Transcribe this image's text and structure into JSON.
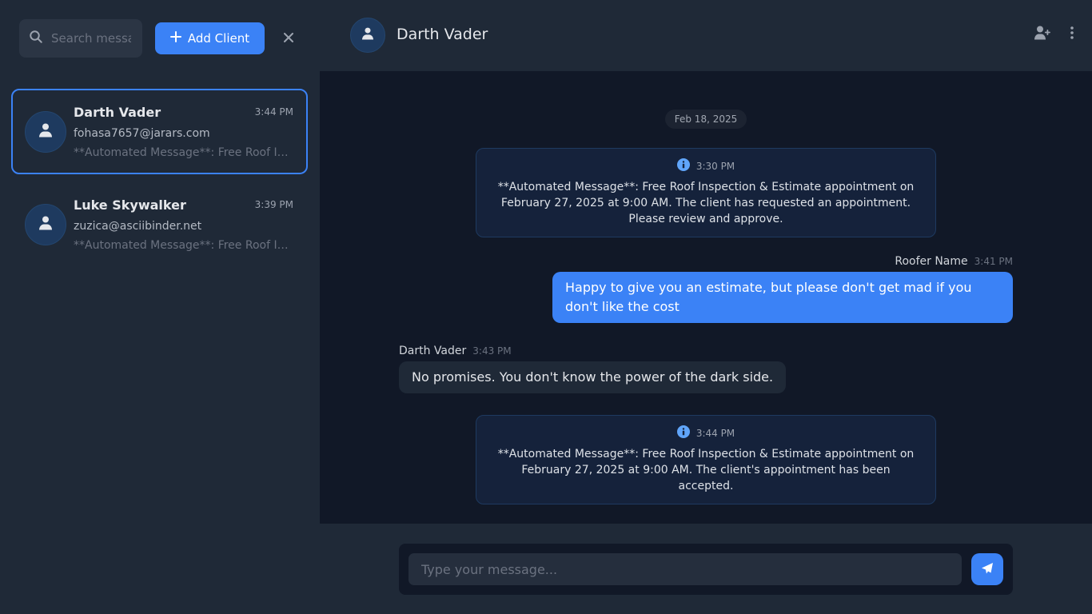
{
  "sidebar": {
    "search": {
      "placeholder": "Search messages...",
      "value": "",
      "icon": "search-icon"
    },
    "add_client_label": "Add Client",
    "close_icon": "close-icon",
    "clients": [
      {
        "name": "Darth Vader",
        "time": "3:44 PM",
        "email": "fohasa7657@jarars.com",
        "preview": "**Automated Message**: Free Roof Inspection & Estimate appointment on February 27, 2025 at 9:00 AM.",
        "active": true
      },
      {
        "name": "Luke Skywalker",
        "time": "3:39 PM",
        "email": "zuzica@asciibinder.net",
        "preview": "**Automated Message**: Free Roof Inspection & Estimate appointment on February 27, 2025 at 9:00 AM.",
        "active": false
      }
    ]
  },
  "header": {
    "title": "Darth Vader",
    "icons": [
      "user-plus-icon",
      "more-vertical-icon"
    ]
  },
  "chat": {
    "date": "Feb 18, 2025",
    "messages": [
      {
        "type": "system",
        "time": "3:30 PM",
        "text": "**Automated Message**: Free Roof Inspection & Estimate appointment on February 27, 2025 at 9:00 AM. The client has requested an appointment. Please review and approve."
      },
      {
        "type": "outgoing",
        "sender": "Roofer Name",
        "time": "3:41 PM",
        "text": "Happy to give you an estimate, but please don't get mad if you don't like the cost"
      },
      {
        "type": "incoming",
        "sender": "Darth Vader",
        "time": "3:43 PM",
        "text": "No promises. You don't know the power of the dark side."
      },
      {
        "type": "system",
        "time": "3:44 PM",
        "text": "**Automated Message**: Free Roof Inspection & Estimate appointment on February 27, 2025 at 9:00 AM. The client's appointment has been accepted."
      }
    ]
  },
  "composer": {
    "placeholder": "Type your message...",
    "value": "",
    "send_icon": "send-icon"
  },
  "colors": {
    "accent": "#3b82f6",
    "panel": "#1f2937",
    "chat_bg": "#111827"
  }
}
